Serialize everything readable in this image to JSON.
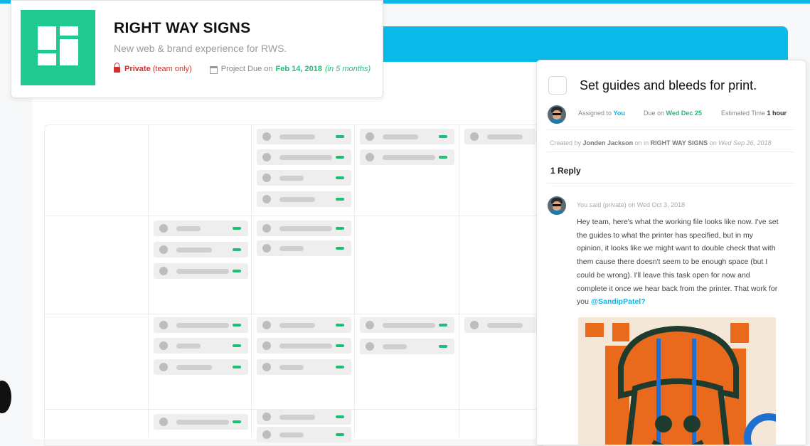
{
  "project": {
    "title": "RIGHT WAY SIGNS",
    "subtitle": "New web & brand experience for RWS.",
    "privacy": "Private",
    "privacy_note": "(team only)",
    "due_label": "Project Due on",
    "due_date": "Feb 14, 2018",
    "due_relative": "(in 5 months)"
  },
  "task": {
    "title": "Set guides and bleeds for print.",
    "assigned_label": "Assigned to",
    "assignee": "You",
    "due_label": "Due on",
    "due_date": "Wed Dec 25",
    "estimate_label": "Estimated Time",
    "estimate": "1 hour",
    "created_by_label": "Created by",
    "creator": "Jonden Jackson",
    "in_label": "on in",
    "project": "RIGHT WAY SIGNS",
    "on_label": "on",
    "created_date": "Wed Sep 26, 2018",
    "reply_count": "1 Reply"
  },
  "comment": {
    "header": "You said (private) on Wed Oct 3, 2018",
    "body": "Hey team, here's what the working file looks like now. I've set the guides to what the printer has specified, but in my opinion, it looks like we might want to double check that with them cause there doesn't seem to be enough space (but I could be wrong). I'll leave this task open for now and complete it once we hear back from the printer. That work for you",
    "mention": "@SandipPatel?"
  },
  "colors": {
    "accent": "#0cb8e6",
    "brand_green": "#1fc98f",
    "status_green": "#1cbf73",
    "private_red": "#d0312d",
    "mention_teal": "#0ab4e0"
  }
}
